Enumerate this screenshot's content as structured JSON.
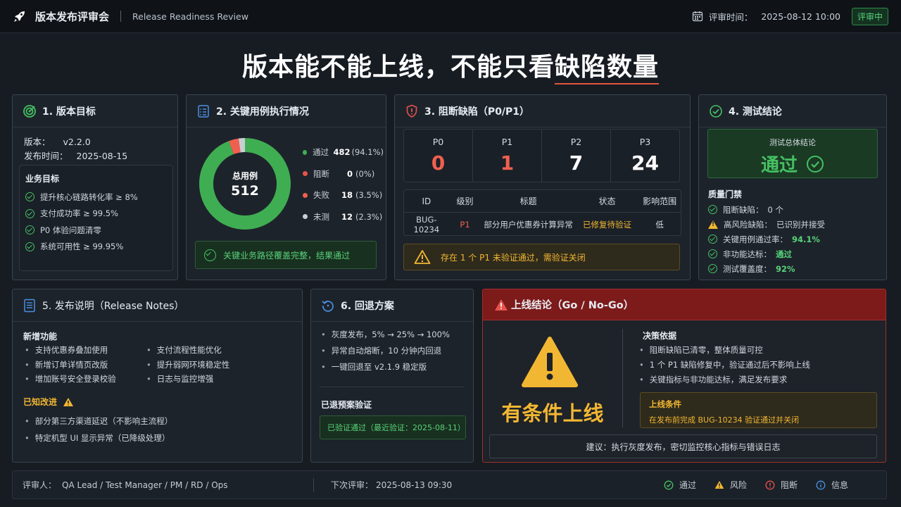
{
  "topbar": {
    "title": "版本发布评审会",
    "subtitle": "Release Readiness Review",
    "review_time_label": "评审时间：",
    "review_time": "2025-08-12 10:00",
    "status_badge": "评审中"
  },
  "headline": {
    "prefix": "版本能不能上线，不能只看",
    "highlight": "缺陷数量"
  },
  "goal": {
    "title": "1. 版本目标",
    "version_label": "版本：",
    "version": "v2.2.0",
    "release_label": "发布时间：",
    "release_date": "2025-08-15",
    "biz_title": "业务目标",
    "items": [
      "提升核心链路转化率 ≥ 8%",
      "支付成功率 ≥ 99.5%",
      "P0 体验问题清零",
      "系统可用性 ≥ 99.95%"
    ]
  },
  "execution": {
    "title": "2. 关键用例执行情况",
    "total_label": "总用例",
    "total": "512",
    "legend": [
      {
        "name": "通过",
        "count": "482",
        "pct": "(94.1%)",
        "value": 482,
        "color": "#3fae52"
      },
      {
        "name": "阻断",
        "count": "0",
        "pct": "(0%)",
        "value": 0,
        "color": "#e5534b"
      },
      {
        "name": "失败",
        "count": "18",
        "pct": "(3.5%)",
        "value": 18,
        "color": "#f0604f"
      },
      {
        "name": "未测",
        "count": "12",
        "pct": "(2.3%)",
        "value": 12,
        "color": "#c9ced4"
      }
    ],
    "summary": "关键业务路径覆盖完整，结果通过"
  },
  "blockers": {
    "title": "3. 阻断缺陷（P0/P1）",
    "levels": [
      {
        "label": "P0",
        "value": "0",
        "color": "#f0604f"
      },
      {
        "label": "P1",
        "value": "1",
        "color": "#f0604f"
      },
      {
        "label": "P2",
        "value": "7",
        "color": "#ffffff"
      },
      {
        "label": "P3",
        "value": "24",
        "color": "#ffffff"
      }
    ],
    "table_headers": [
      "ID",
      "级别",
      "标题",
      "状态",
      "影响范围"
    ],
    "row": {
      "id": "BUG-10234",
      "level": "P1",
      "title": "部分用户优惠券计算异常",
      "status": "已修复待验证",
      "scope": "低"
    },
    "alert": "存在 1 个 P1 未验证通过，需验证关闭"
  },
  "conclusion": {
    "title": "4. 测试结论",
    "overall_label": "测试总体结论",
    "overall_value": "通过",
    "gates_title": "质量门禁",
    "gates": [
      {
        "type": "ok",
        "label": "阻断缺陷：",
        "value": "0 个",
        "highlight": false
      },
      {
        "type": "warn",
        "label": "高风险缺陷：",
        "value": "已识别并接受",
        "highlight": false
      },
      {
        "type": "ok",
        "label": "关键用例通过率：",
        "value": "94.1%",
        "highlight": true
      },
      {
        "type": "ok",
        "label": "非功能达标：",
        "value": "通过",
        "highlight": true
      },
      {
        "type": "ok",
        "label": "测试覆盖度：",
        "value": "92%",
        "highlight": true
      }
    ]
  },
  "notes": {
    "title": "5. 发布说明（Release Notes）",
    "features_title": "新增功能",
    "features_left": [
      "支持优惠券叠加使用",
      "新增订单详情页改版",
      "增加账号安全登录校验"
    ],
    "features_right": [
      "支付流程性能优化",
      "提升弱网环境稳定性",
      "日志与监控增强"
    ],
    "known_title": "已知改进",
    "known": [
      "部分第三方渠道延迟（不影响主流程）",
      "特定机型 UI 显示异常（已降级处理）"
    ]
  },
  "rollback": {
    "title": "6. 回退方案",
    "steps": [
      "灰度发布，5% → 25% → 100%",
      "异常自动熔断，10 分钟内回退",
      "一键回退至 v2.1.9 稳定版"
    ],
    "verify_title": "已退预案验证",
    "verify_status": "已验证通过（最近验证：2025-08-11）"
  },
  "decision": {
    "title": "上线结论（Go / No-Go）",
    "verdict": "有条件上线",
    "basis_title": "决策依据",
    "basis": [
      "阻断缺陷已清零，整体质量可控",
      "1 个 P1 缺陷修复中，验证通过后不影响上线",
      "关键指标与非功能达标，满足发布要求"
    ],
    "condition_title": "上线条件",
    "condition": "在发布前完成 BUG-10234 验证通过并关闭",
    "advice": "建议：执行灰度发布，密切监控核心指标与错误日志"
  },
  "footer": {
    "reviewers_label": "评审人：",
    "reviewers": "QA Lead / Test Manager / PM / RD / Ops",
    "next_label": "下次评审：",
    "next_time": "2025-08-13 09:30",
    "legend": [
      "通过",
      "风险",
      "阻断",
      "信息"
    ]
  },
  "colors": {
    "pass": "#45c062",
    "risk": "#f2b732",
    "block": "#e5534b",
    "info": "#4a90e2",
    "brand_red": "#8c1d1d"
  }
}
